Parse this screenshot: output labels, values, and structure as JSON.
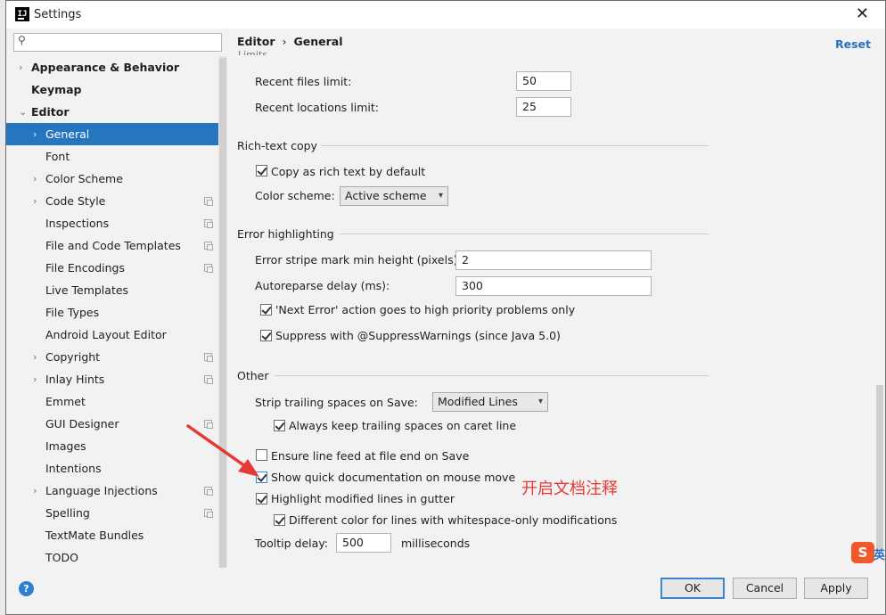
{
  "window": {
    "title": "Settings",
    "close_glyph": "✕"
  },
  "search": {
    "placeholder": "",
    "icon": "search-icon"
  },
  "sidebar": {
    "items": [
      {
        "label": "Appearance & Behavior",
        "arrow": "›",
        "bold": true
      },
      {
        "label": "Keymap",
        "arrow": "",
        "bold": true
      },
      {
        "label": "Editor",
        "arrow": "⌄",
        "bold": true
      },
      {
        "label": "General",
        "arrow": "›",
        "selected": true
      },
      {
        "label": "Font",
        "arrow": ""
      },
      {
        "label": "Color Scheme",
        "arrow": "›"
      },
      {
        "label": "Code Style",
        "arrow": "›",
        "copy": true
      },
      {
        "label": "Inspections",
        "arrow": "",
        "copy": true
      },
      {
        "label": "File and Code Templates",
        "arrow": "",
        "copy": true
      },
      {
        "label": "File Encodings",
        "arrow": "",
        "copy": true
      },
      {
        "label": "Live Templates",
        "arrow": ""
      },
      {
        "label": "File Types",
        "arrow": ""
      },
      {
        "label": "Android Layout Editor",
        "arrow": ""
      },
      {
        "label": "Copyright",
        "arrow": "›",
        "copy": true
      },
      {
        "label": "Inlay Hints",
        "arrow": "›",
        "copy": true
      },
      {
        "label": "Emmet",
        "arrow": ""
      },
      {
        "label": "GUI Designer",
        "arrow": "",
        "copy": true
      },
      {
        "label": "Images",
        "arrow": ""
      },
      {
        "label": "Intentions",
        "arrow": ""
      },
      {
        "label": "Language Injections",
        "arrow": "›",
        "copy": true
      },
      {
        "label": "Spelling",
        "arrow": "",
        "copy": true
      },
      {
        "label": "TextMate Bundles",
        "arrow": ""
      },
      {
        "label": "TODO",
        "arrow": ""
      }
    ]
  },
  "header": {
    "crumb_parent": "Editor",
    "crumb_sep": "›",
    "crumb_current": "General",
    "reset": "Reset"
  },
  "limits": {
    "cut_label": "Limits",
    "recent_files_label": "Recent files limit:",
    "recent_files_value": "50",
    "recent_locations_label": "Recent locations limit:",
    "recent_locations_value": "25"
  },
  "rich_text": {
    "title": "Rich-text copy",
    "copy_default_label": "Copy as rich text by default",
    "copy_default_checked": true,
    "scheme_label": "Color scheme:",
    "scheme_value": "Active scheme"
  },
  "error_highlighting": {
    "title": "Error highlighting",
    "stripe_label": "Error stripe mark min height (pixels):",
    "stripe_value": "2",
    "autoreparse_label": "Autoreparse delay (ms):",
    "autoreparse_value": "300",
    "next_error_label": "'Next Error' action goes to high priority problems only",
    "next_error_checked": true,
    "suppress_label": "Suppress with @SuppressWarnings (since Java 5.0)",
    "suppress_checked": true
  },
  "other": {
    "title": "Other",
    "strip_label": "Strip trailing spaces on Save:",
    "strip_value": "Modified Lines",
    "keep_trailing_label": "Always keep trailing spaces on caret line",
    "keep_trailing_checked": true,
    "ensure_lf_label": "Ensure line feed at file end on Save",
    "ensure_lf_checked": false,
    "quick_doc_label": "Show quick documentation on mouse move",
    "quick_doc_checked": true,
    "highlight_modified_label": "Highlight modified lines in gutter",
    "highlight_modified_checked": true,
    "different_color_label": "Different color for lines with whitespace-only modifications",
    "different_color_checked": true,
    "tooltip_label": "Tooltip delay:",
    "tooltip_value": "500",
    "tooltip_unit": "milliseconds"
  },
  "annotation": {
    "text": "开启文档注释",
    "color": "#e53935"
  },
  "footer": {
    "help": "?",
    "ok": "OK",
    "cancel": "Cancel",
    "apply": "Apply"
  },
  "ime": {
    "logo": "S",
    "text": "英"
  },
  "colors": {
    "accent": "#2675bf",
    "link": "#2872c2",
    "annotation": "#e53935"
  }
}
